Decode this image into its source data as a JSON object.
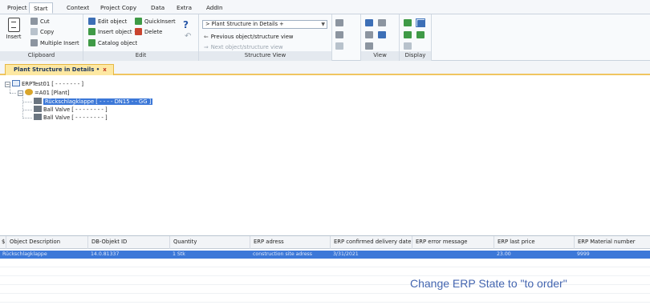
{
  "menu": {
    "tabs": [
      "Project",
      "Start",
      "Context",
      "Project Copy",
      "Data",
      "Extra",
      "AddIn"
    ],
    "active_tab": "Start"
  },
  "ribbon": {
    "clipboard": {
      "insert_label": "Insert",
      "cut_label": "Cut",
      "copy_label": "Copy",
      "multiple_insert_label": "Multiple Insert",
      "group_label": "Clipboard"
    },
    "edit": {
      "edit_object_label": "Edit object",
      "quickinsert_label": "QuickInsert",
      "insert_object_label": "Insert object •",
      "delete_label": "Delete",
      "catalog_object_label": "Catalog object",
      "group_label": "Edit"
    },
    "structure_view": {
      "combo_value": "> Plant Structure in Details +",
      "previous_label": "Previous object/structure view",
      "next_label": "Next object/structure view",
      "group_label": "Structure View"
    },
    "view": {
      "group_label": "View"
    },
    "display": {
      "group_label": "Display"
    }
  },
  "doc_tab": {
    "label": "Plant Structure in Details •",
    "close": "x"
  },
  "tree": {
    "root": "ERPTest01   [ - - - - - - - ]",
    "plant": "=A01   [Plant]",
    "items": [
      "Rückschlagklappe   [ - - - - DN15 - - GG ]",
      "Ball Valve   [ - - - - - - - - ]",
      "Ball Valve   [ - - - - - - - - ]"
    ]
  },
  "grid": {
    "columns": [
      "Object Description",
      "DB-Objekt ID",
      "Quantity",
      "ERP adress",
      "ERP confirmed delivery date",
      "ERP error message",
      "ERP last price",
      "ERP Material number"
    ],
    "rows": [
      [
        "Rückschlagklappe",
        "14.0.81337",
        "1 Stk",
        "construction site adress",
        "3/31/2021",
        "",
        "23.00",
        "9999"
      ]
    ]
  },
  "annotation": "Change ERP State to \"to order\""
}
